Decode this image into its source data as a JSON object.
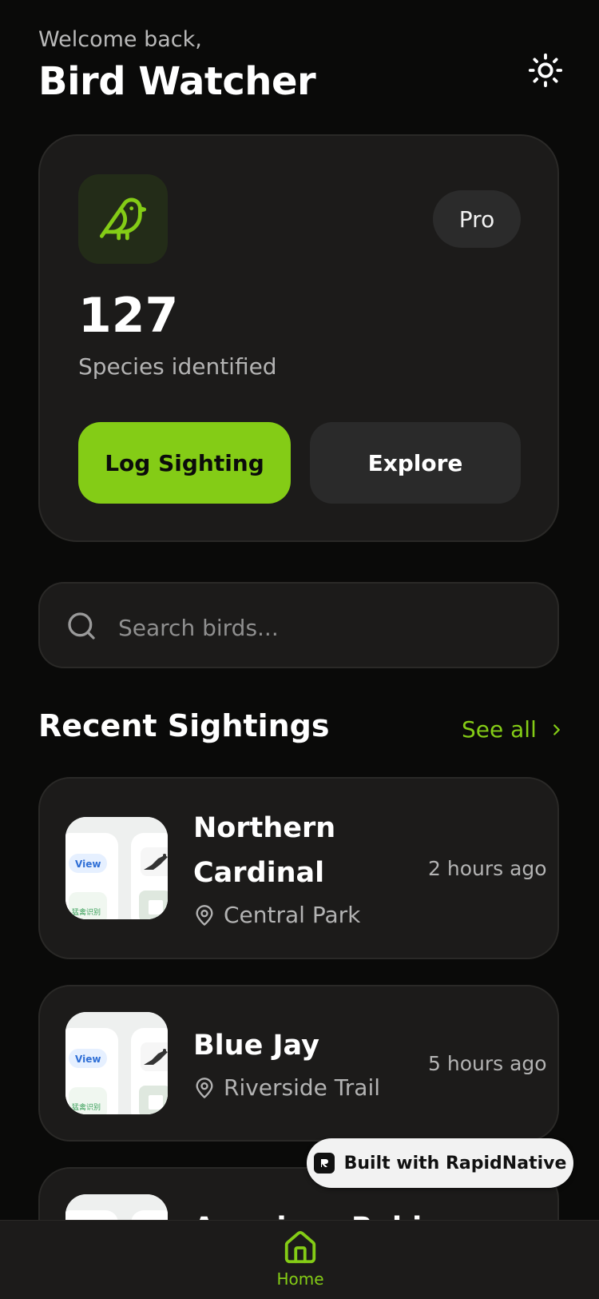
{
  "header": {
    "welcome": "Welcome back,",
    "title": "Bird Watcher",
    "theme_toggle_icon": "sun-icon"
  },
  "stats_card": {
    "badge": "Pro",
    "count": "127",
    "count_label": "Species identified",
    "primary_button": "Log Sighting",
    "secondary_button": "Explore"
  },
  "search": {
    "placeholder": "Search birds..."
  },
  "recent": {
    "title": "Recent Sightings",
    "see_all": "See all",
    "items": [
      {
        "name_line1": "Northern",
        "name_line2": "Cardinal",
        "location": "Central Park",
        "time": "2 hours ago"
      },
      {
        "name": "Blue Jay",
        "location": "Riverside Trail",
        "time": "5 hours ago"
      },
      {
        "name": "American Robin"
      }
    ],
    "thumb_text": {
      "view": "View",
      "cn": "猛禽识别"
    }
  },
  "badge": {
    "label": "Built with RapidNative"
  },
  "tabbar": {
    "home": "Home"
  },
  "colors": {
    "accent": "#84cc16",
    "background": "#0a0a09",
    "card": "#1c1b1a",
    "muted_text": "#b3b3b3"
  }
}
